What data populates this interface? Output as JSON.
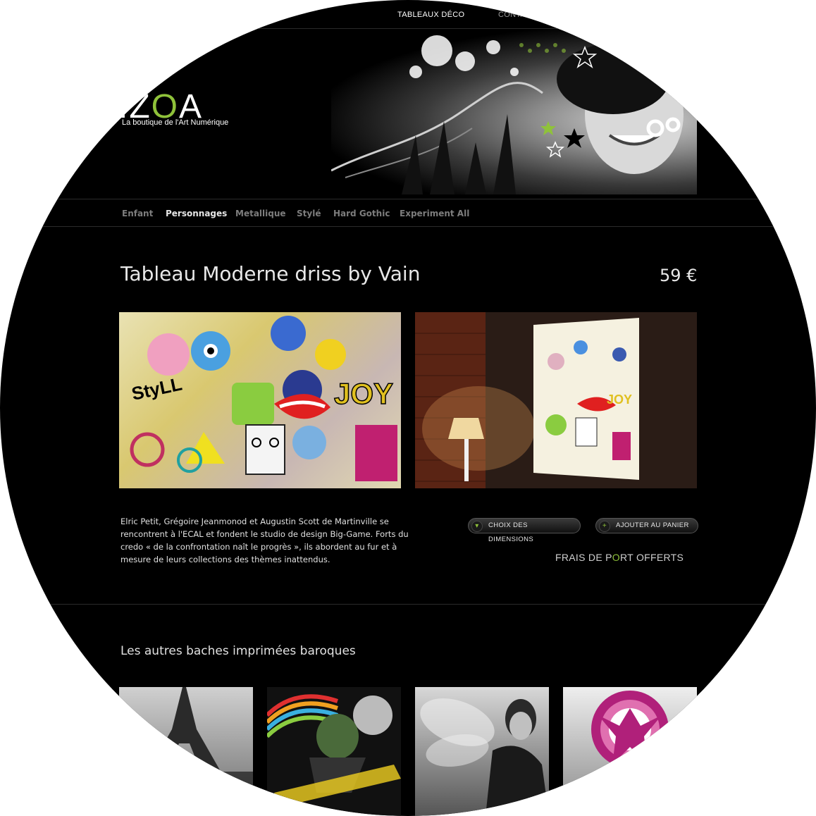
{
  "topnav": {
    "item1": "TABLEAUX DÉCO",
    "item2": "CONTA"
  },
  "logo": {
    "prefix": "IZ",
    "o": "O",
    "suffix": "A",
    "tagline": "La boutique de l'Art Numérique"
  },
  "categories": [
    "Enfant",
    "Personnages",
    "Metallique",
    "Stylé",
    "Hard Gothic",
    "Experiment All"
  ],
  "product": {
    "title": "Tableau Moderne driss by Vain",
    "price": "59 €",
    "description": "Elric Petit, Grégoire Jeanmonod et Augustin Scott de Martinville se rencontrent à l'ECAL et fondent le studio de design Big-Game. Forts du credo « de la confrontation naît le progrès », ils abordent au fur et à mesure de leurs collections des thèmes inattendus."
  },
  "buttons": {
    "dimensions": "CHOIX DES DIMENSIONS",
    "dimensions_icon": "▾",
    "cart": "AJOUTER AU PANIER",
    "cart_icon": "+"
  },
  "shipping": {
    "before": "FRAIS DE P",
    "o": "O",
    "after": "RT OFFERTS"
  },
  "related_heading": "Les autres baches imprimées baroques",
  "colors": {
    "accent": "#8fc23a",
    "background": "#000000"
  }
}
